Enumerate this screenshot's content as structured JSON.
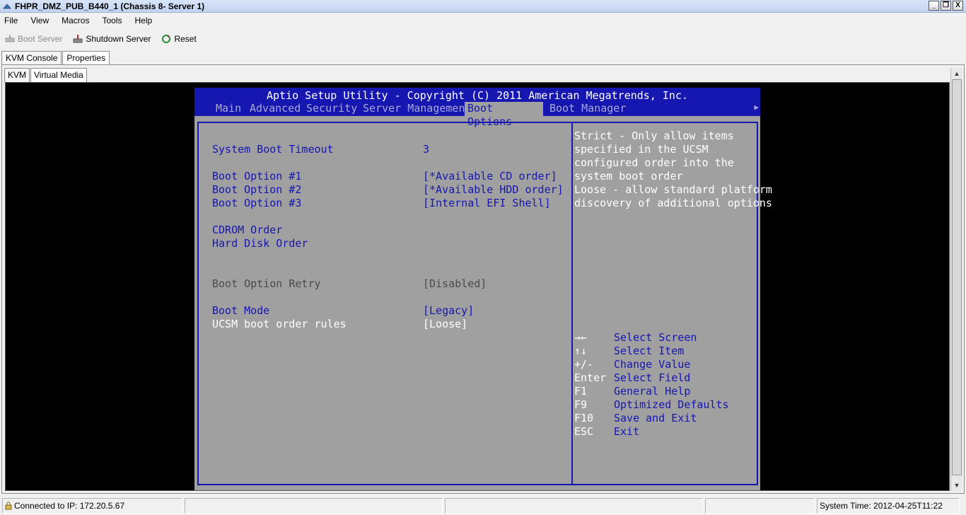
{
  "window": {
    "title": "FHPR_DMZ_PUB_B440_1 (Chassis 8- Server 1)",
    "buttons": [
      "_",
      "❐",
      "X"
    ]
  },
  "menu": [
    "File",
    "View",
    "Macros",
    "Tools",
    "Help"
  ],
  "toolbar": {
    "boot": "Boot Server",
    "shutdown": "Shutdown Server",
    "reset": "Reset"
  },
  "tabs_top": [
    "KVM Console",
    "Properties"
  ],
  "tabs_inner": [
    "KVM",
    "Virtual Media"
  ],
  "bios": {
    "title": "Aptio Setup Utility - Copyright (C) 2011 American Megatrends, Inc.",
    "tabs": [
      "Main",
      "Advanced",
      "Security",
      "Server Management",
      "Boot Options",
      "Boot Manager"
    ],
    "selected_tab": "Boot Options",
    "settings": [
      {
        "label": "System Boot Timeout",
        "value": "3",
        "color": "#1616b0"
      },
      {
        "label": "Boot Option #1",
        "value": "[*Available CD order]",
        "color": "#1616b0"
      },
      {
        "label": "Boot Option #2",
        "value": "[*Available HDD order]",
        "color": "#1616b0"
      },
      {
        "label": "Boot Option #3",
        "value": "[Internal EFI Shell]",
        "color": "#1616b0"
      },
      {
        "label": "CDROM Order",
        "value": "",
        "color": "#1616b0"
      },
      {
        "label": "Hard Disk Order",
        "value": "",
        "color": "#1616b0"
      },
      {
        "label": "Boot Option Retry",
        "value": "[Disabled]",
        "color": "#4a4a4a"
      },
      {
        "label": "Boot Mode",
        "value": "[Legacy]",
        "color": "#1616b0"
      },
      {
        "label": "UCSM boot order rules",
        "value": "[Loose]",
        "color": "#ffffff"
      }
    ],
    "help": [
      "Strict - Only allow items",
      "specified in the UCSM",
      "configured order into the",
      "system boot order",
      "Loose - allow standard platform",
      "discovery of additional options"
    ],
    "keys": [
      {
        "key": "→←",
        "desc": "Select Screen"
      },
      {
        "key": "↑↓",
        "desc": "Select Item"
      },
      {
        "key": "+/-",
        "desc": "Change Value"
      },
      {
        "key": "Enter",
        "desc": "Select Field"
      },
      {
        "key": "F1",
        "desc": "General Help"
      },
      {
        "key": "F9",
        "desc": "Optimized Defaults"
      },
      {
        "key": "F10",
        "desc": "Save and Exit"
      },
      {
        "key": "ESC",
        "desc": "Exit"
      }
    ]
  },
  "status": {
    "connection": "Connected to IP: 172.20.5.67",
    "time": "System Time: 2012-04-25T11:22"
  }
}
